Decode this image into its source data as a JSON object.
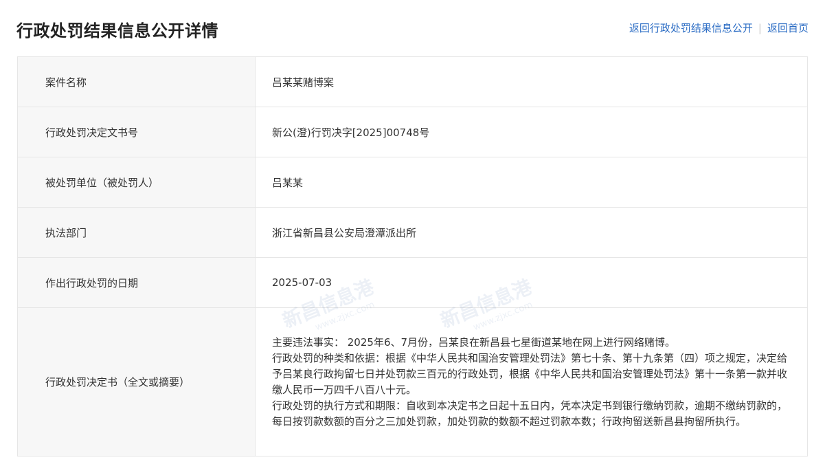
{
  "header": {
    "title": "行政处罚结果信息公开详情",
    "back_to_list": "返回行政处罚结果信息公开",
    "separator": "|",
    "back_home": "返回首页"
  },
  "rows": [
    {
      "label": "案件名称",
      "value": "吕某某赌博案"
    },
    {
      "label": "行政处罚决定文书号",
      "value": "新公(澄)行罚决字[2025]00748号"
    },
    {
      "label": "被处罚单位（被处罚人）",
      "value": "吕某某"
    },
    {
      "label": "执法部门",
      "value": "浙江省新昌县公安局澄潭派出所"
    },
    {
      "label": "作出行政处罚的日期",
      "value": "2025-07-03"
    }
  ],
  "decision": {
    "label": "行政处罚决定书（全文或摘要）",
    "paragraphs": [
      "主要违法事实： 2025年6、7月份，吕某良在新昌县七星街道某地在网上进行网络赌博。",
      "行政处罚的种类和依据：根据《中华人民共和国治安管理处罚法》第七十条、第十九条第（四）项之规定，决定给予吕某良行政拘留七日并处罚款三百元的行政处罚，根据《中华人民共和国治安管理处罚法》第十一条第一款并收缴人民币一万四千八百八十元。",
      "行政处罚的执行方式和期限：自收到本决定书之日起十五日内，凭本决定书到银行缴纳罚款，逾期不缴纳罚款的，每日按罚款数额的百分之三加处罚款，加处罚款的数额不超过罚款本数；行政拘留送新昌县拘留所执行。"
    ]
  },
  "watermarks": [
    {
      "text": "新昌信息港",
      "sub": "www.zjxc.com"
    },
    {
      "text": "新昌信息港",
      "sub": "www.zjxc.com"
    }
  ],
  "colors": {
    "link": "#2b6cc4",
    "label_bg": "#f7f7f7",
    "border": "#e6e6e6"
  }
}
